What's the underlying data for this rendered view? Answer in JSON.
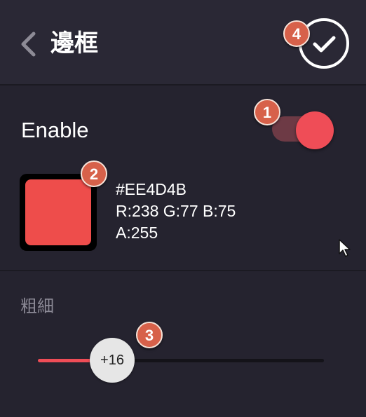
{
  "header": {
    "title": "邊框",
    "back_icon": "chevron-left-icon",
    "confirm_icon": "checkmark-circle-icon"
  },
  "enable": {
    "label": "Enable",
    "value": true
  },
  "color": {
    "hex_label": "#EE4D4B",
    "rgb_label": "R:238 G:77 B:75",
    "alpha_label": "A:255",
    "swatch_color": "#EE4D4B"
  },
  "thickness": {
    "label": "粗細",
    "value_label": "+16",
    "fraction": 0.26
  },
  "badges": [
    "1",
    "2",
    "3",
    "4"
  ],
  "colors": {
    "accent": "#ef4d57",
    "background": "#25232f",
    "badge": "#d7614a"
  }
}
